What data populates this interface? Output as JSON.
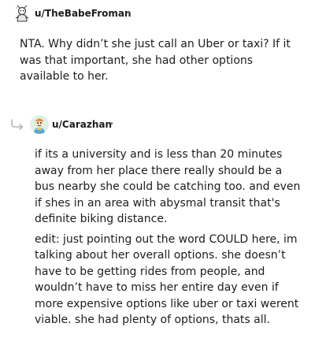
{
  "comments": [
    {
      "username": "u/TheBabeFroman",
      "separator": "•",
      "avatar_icon": "snoo-avatar-icon",
      "paragraphs": [
        "NTA. Why didn’t she just call an Uber or taxi? If it was that important, she had other options available to her."
      ]
    },
    {
      "username": "u/Carazhan",
      "separator": "•",
      "avatar_icon": "snoo-avatar-icon",
      "reply_icon": "reply-arrow-icon",
      "paragraphs": [
        "if its a university and is less than 20 minutes away from her place there really should be a bus nearby she could be catching too. and even if shes in an area with abysmal transit that's definite biking distance.",
        "edit: just pointing out the word COULD here, im talking about her overall options. she doesn’t have to be getting rides from people, and wouldn’t have to miss her entire day even if more expensive options like uber or taxi werent viable. she had plenty of options, thats all."
      ]
    }
  ]
}
